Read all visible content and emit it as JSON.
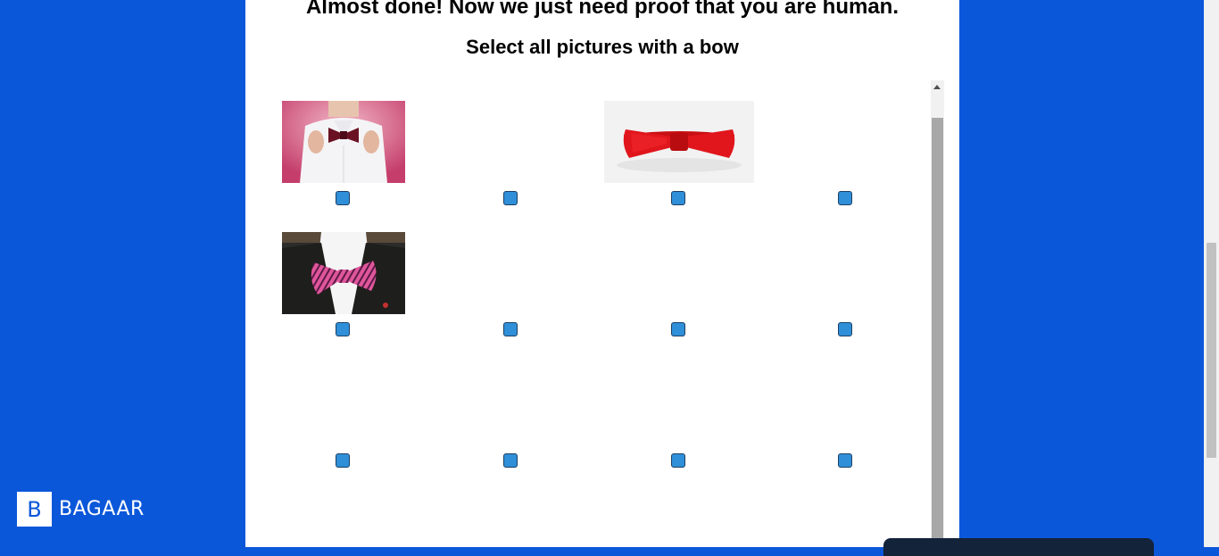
{
  "captcha": {
    "title": "Almost done! Now we just need proof that you are human.",
    "instruction": "Select all pictures with a bow"
  },
  "grid": {
    "rows": 3,
    "columns": 4,
    "cells": [
      {
        "image": "man-with-maroon-bowtie",
        "checked": false
      },
      {
        "image": null,
        "checked": false
      },
      {
        "image": "red-bowtie",
        "checked": false
      },
      {
        "image": null,
        "checked": false
      },
      {
        "image": "pink-striped-bowtie",
        "checked": false
      },
      {
        "image": null,
        "checked": false
      },
      {
        "image": null,
        "checked": false
      },
      {
        "image": null,
        "checked": false
      },
      {
        "image": null,
        "checked": false
      },
      {
        "image": null,
        "checked": false
      },
      {
        "image": null,
        "checked": false
      },
      {
        "image": null,
        "checked": false
      }
    ]
  },
  "brand": {
    "logo_letter": "B",
    "name": "BAGAAR"
  },
  "colors": {
    "background": "#0b57d9",
    "checkbox_fill": "#2f8fd8",
    "checkbox_border": "#1d3f63"
  }
}
